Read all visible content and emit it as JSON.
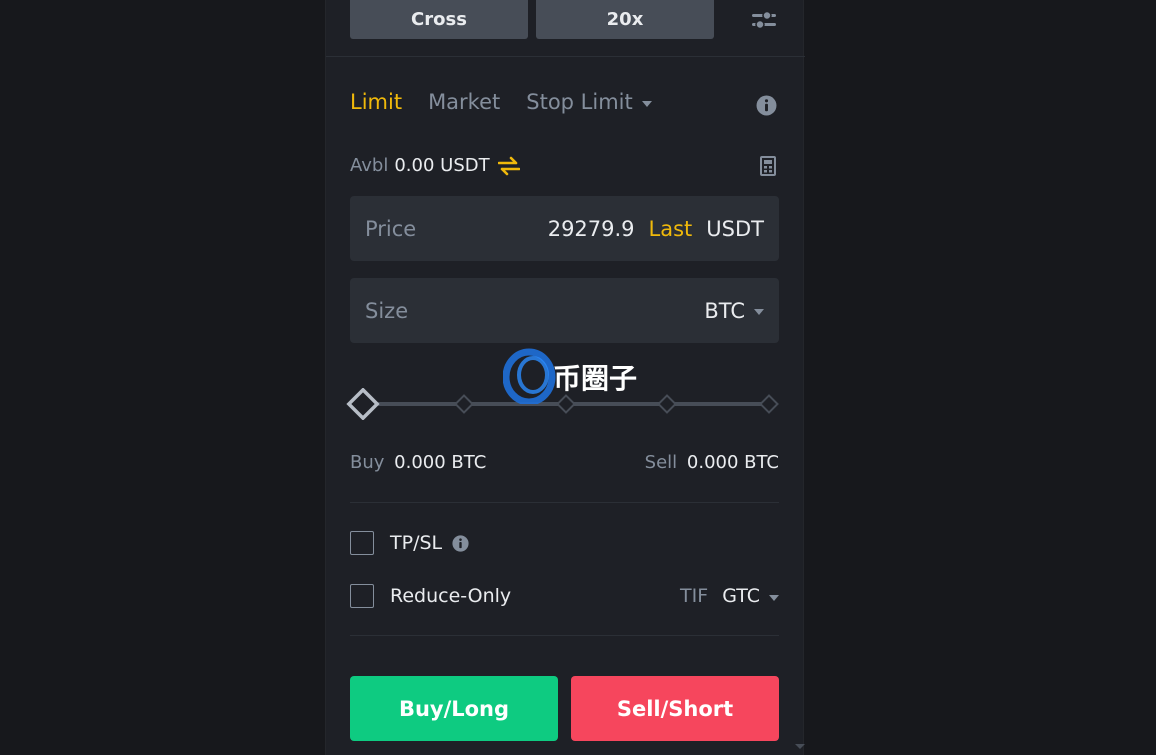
{
  "margin": {
    "mode": "Cross",
    "leverage": "20x"
  },
  "order_tabs": [
    {
      "label": "Limit",
      "active": true
    },
    {
      "label": "Market",
      "active": false
    },
    {
      "label": "Stop Limit",
      "active": false,
      "dropdown": true
    }
  ],
  "available": {
    "label": "Avbl",
    "value": "0.00 USDT"
  },
  "price_field": {
    "label": "Price",
    "value": "29279.9",
    "mode": "Last",
    "unit": "USDT"
  },
  "size_field": {
    "label": "Size",
    "unit": "BTC"
  },
  "slider": {
    "level_percent": 0,
    "steps": [
      0,
      25,
      50,
      75,
      100
    ]
  },
  "buy_sell": {
    "buy_label": "Buy",
    "buy_value": "0.000 BTC",
    "sell_label": "Sell",
    "sell_value": "0.000 BTC"
  },
  "options": {
    "tpsl_label": "TP/SL",
    "reduce_only_label": "Reduce-Only",
    "tif_label": "TIF",
    "tif_value": "GTC"
  },
  "actions": {
    "buy_label": "Buy/Long",
    "sell_label": "Sell/Short"
  },
  "watermark_text": "币圈子",
  "icons": {
    "settings": "sliders-icon",
    "info": "info-icon",
    "transfer": "transfer-arrows-icon",
    "calculator": "calculator-icon"
  },
  "colors": {
    "accent": "#f0b90b",
    "buy": "#0ecb81",
    "sell": "#f6465d",
    "panel": "#1e2026",
    "field": "#2b2f36"
  }
}
